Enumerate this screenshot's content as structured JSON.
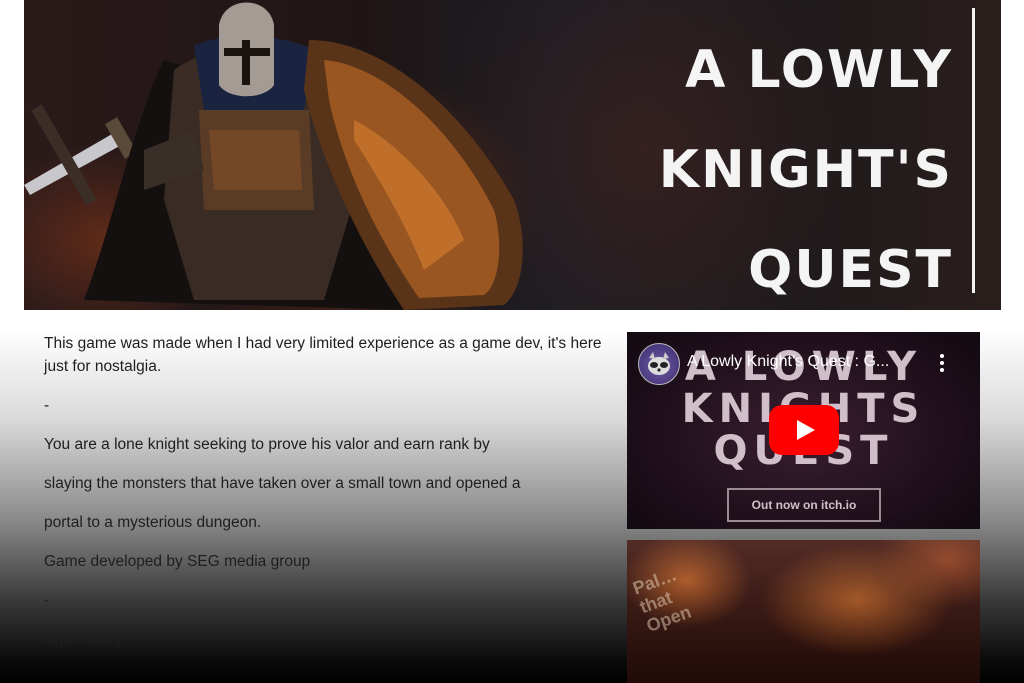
{
  "banner": {
    "title": "A LOWLY\nKNIGHT'S\nQUEST",
    "image": "knight-with-shield-artwork"
  },
  "description": {
    "p1": "This game was made when I had very limited experience as a game dev, it's here just for nostalgia.",
    "sep1": "-",
    "line1": "You are a lone knight seeking to prove his valor and earn rank by",
    "line2": "slaying the monsters that have taken over a small town and opened a",
    "line3": "portal to a mysterious dungeon.",
    "line4": "Game developed by SEG media group",
    "sep2": "-",
    "line5": "Age Rating"
  },
  "video": {
    "title": "A Lowly Knight's Quest : G...",
    "thumbnail_title": "A LOWLY\nKNIGHTS\nQUEST",
    "cta": "Out now on itch.io",
    "icons": [
      "channel-avatar",
      "kebab-menu-icon",
      "youtube-play-icon"
    ],
    "colors": {
      "play": "#ff0000"
    }
  },
  "video2": {
    "thumbnail_text": "Pal…\nthat\nOpen"
  }
}
